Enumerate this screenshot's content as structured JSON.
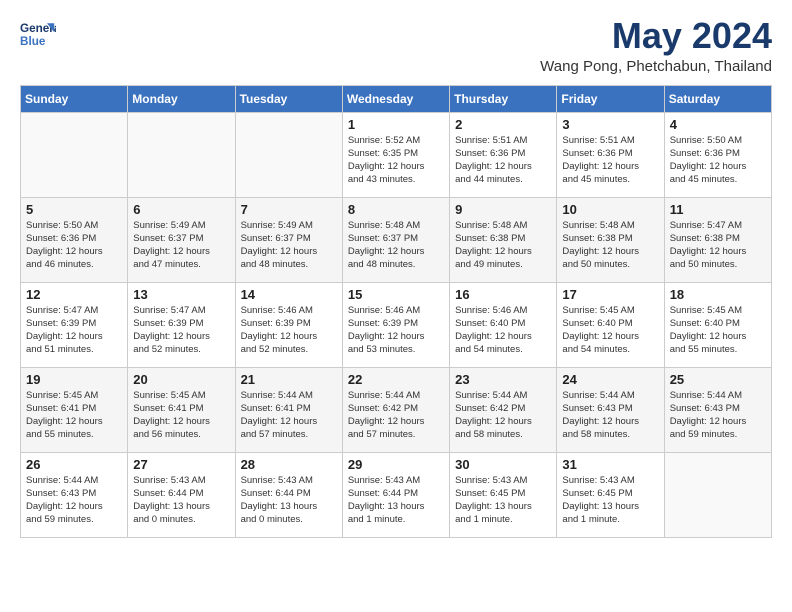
{
  "logo": {
    "line1": "General",
    "line2": "Blue"
  },
  "title": "May 2024",
  "location": "Wang Pong, Phetchabun, Thailand",
  "days_of_week": [
    "Sunday",
    "Monday",
    "Tuesday",
    "Wednesday",
    "Thursday",
    "Friday",
    "Saturday"
  ],
  "weeks": [
    [
      {
        "day": "",
        "info": ""
      },
      {
        "day": "",
        "info": ""
      },
      {
        "day": "",
        "info": ""
      },
      {
        "day": "1",
        "info": "Sunrise: 5:52 AM\nSunset: 6:35 PM\nDaylight: 12 hours\nand 43 minutes."
      },
      {
        "day": "2",
        "info": "Sunrise: 5:51 AM\nSunset: 6:36 PM\nDaylight: 12 hours\nand 44 minutes."
      },
      {
        "day": "3",
        "info": "Sunrise: 5:51 AM\nSunset: 6:36 PM\nDaylight: 12 hours\nand 45 minutes."
      },
      {
        "day": "4",
        "info": "Sunrise: 5:50 AM\nSunset: 6:36 PM\nDaylight: 12 hours\nand 45 minutes."
      }
    ],
    [
      {
        "day": "5",
        "info": "Sunrise: 5:50 AM\nSunset: 6:36 PM\nDaylight: 12 hours\nand 46 minutes."
      },
      {
        "day": "6",
        "info": "Sunrise: 5:49 AM\nSunset: 6:37 PM\nDaylight: 12 hours\nand 47 minutes."
      },
      {
        "day": "7",
        "info": "Sunrise: 5:49 AM\nSunset: 6:37 PM\nDaylight: 12 hours\nand 48 minutes."
      },
      {
        "day": "8",
        "info": "Sunrise: 5:48 AM\nSunset: 6:37 PM\nDaylight: 12 hours\nand 48 minutes."
      },
      {
        "day": "9",
        "info": "Sunrise: 5:48 AM\nSunset: 6:38 PM\nDaylight: 12 hours\nand 49 minutes."
      },
      {
        "day": "10",
        "info": "Sunrise: 5:48 AM\nSunset: 6:38 PM\nDaylight: 12 hours\nand 50 minutes."
      },
      {
        "day": "11",
        "info": "Sunrise: 5:47 AM\nSunset: 6:38 PM\nDaylight: 12 hours\nand 50 minutes."
      }
    ],
    [
      {
        "day": "12",
        "info": "Sunrise: 5:47 AM\nSunset: 6:39 PM\nDaylight: 12 hours\nand 51 minutes."
      },
      {
        "day": "13",
        "info": "Sunrise: 5:47 AM\nSunset: 6:39 PM\nDaylight: 12 hours\nand 52 minutes."
      },
      {
        "day": "14",
        "info": "Sunrise: 5:46 AM\nSunset: 6:39 PM\nDaylight: 12 hours\nand 52 minutes."
      },
      {
        "day": "15",
        "info": "Sunrise: 5:46 AM\nSunset: 6:39 PM\nDaylight: 12 hours\nand 53 minutes."
      },
      {
        "day": "16",
        "info": "Sunrise: 5:46 AM\nSunset: 6:40 PM\nDaylight: 12 hours\nand 54 minutes."
      },
      {
        "day": "17",
        "info": "Sunrise: 5:45 AM\nSunset: 6:40 PM\nDaylight: 12 hours\nand 54 minutes."
      },
      {
        "day": "18",
        "info": "Sunrise: 5:45 AM\nSunset: 6:40 PM\nDaylight: 12 hours\nand 55 minutes."
      }
    ],
    [
      {
        "day": "19",
        "info": "Sunrise: 5:45 AM\nSunset: 6:41 PM\nDaylight: 12 hours\nand 55 minutes."
      },
      {
        "day": "20",
        "info": "Sunrise: 5:45 AM\nSunset: 6:41 PM\nDaylight: 12 hours\nand 56 minutes."
      },
      {
        "day": "21",
        "info": "Sunrise: 5:44 AM\nSunset: 6:41 PM\nDaylight: 12 hours\nand 57 minutes."
      },
      {
        "day": "22",
        "info": "Sunrise: 5:44 AM\nSunset: 6:42 PM\nDaylight: 12 hours\nand 57 minutes."
      },
      {
        "day": "23",
        "info": "Sunrise: 5:44 AM\nSunset: 6:42 PM\nDaylight: 12 hours\nand 58 minutes."
      },
      {
        "day": "24",
        "info": "Sunrise: 5:44 AM\nSunset: 6:43 PM\nDaylight: 12 hours\nand 58 minutes."
      },
      {
        "day": "25",
        "info": "Sunrise: 5:44 AM\nSunset: 6:43 PM\nDaylight: 12 hours\nand 59 minutes."
      }
    ],
    [
      {
        "day": "26",
        "info": "Sunrise: 5:44 AM\nSunset: 6:43 PM\nDaylight: 12 hours\nand 59 minutes."
      },
      {
        "day": "27",
        "info": "Sunrise: 5:43 AM\nSunset: 6:44 PM\nDaylight: 13 hours\nand 0 minutes."
      },
      {
        "day": "28",
        "info": "Sunrise: 5:43 AM\nSunset: 6:44 PM\nDaylight: 13 hours\nand 0 minutes."
      },
      {
        "day": "29",
        "info": "Sunrise: 5:43 AM\nSunset: 6:44 PM\nDaylight: 13 hours\nand 1 minute."
      },
      {
        "day": "30",
        "info": "Sunrise: 5:43 AM\nSunset: 6:45 PM\nDaylight: 13 hours\nand 1 minute."
      },
      {
        "day": "31",
        "info": "Sunrise: 5:43 AM\nSunset: 6:45 PM\nDaylight: 13 hours\nand 1 minute."
      },
      {
        "day": "",
        "info": ""
      }
    ]
  ]
}
